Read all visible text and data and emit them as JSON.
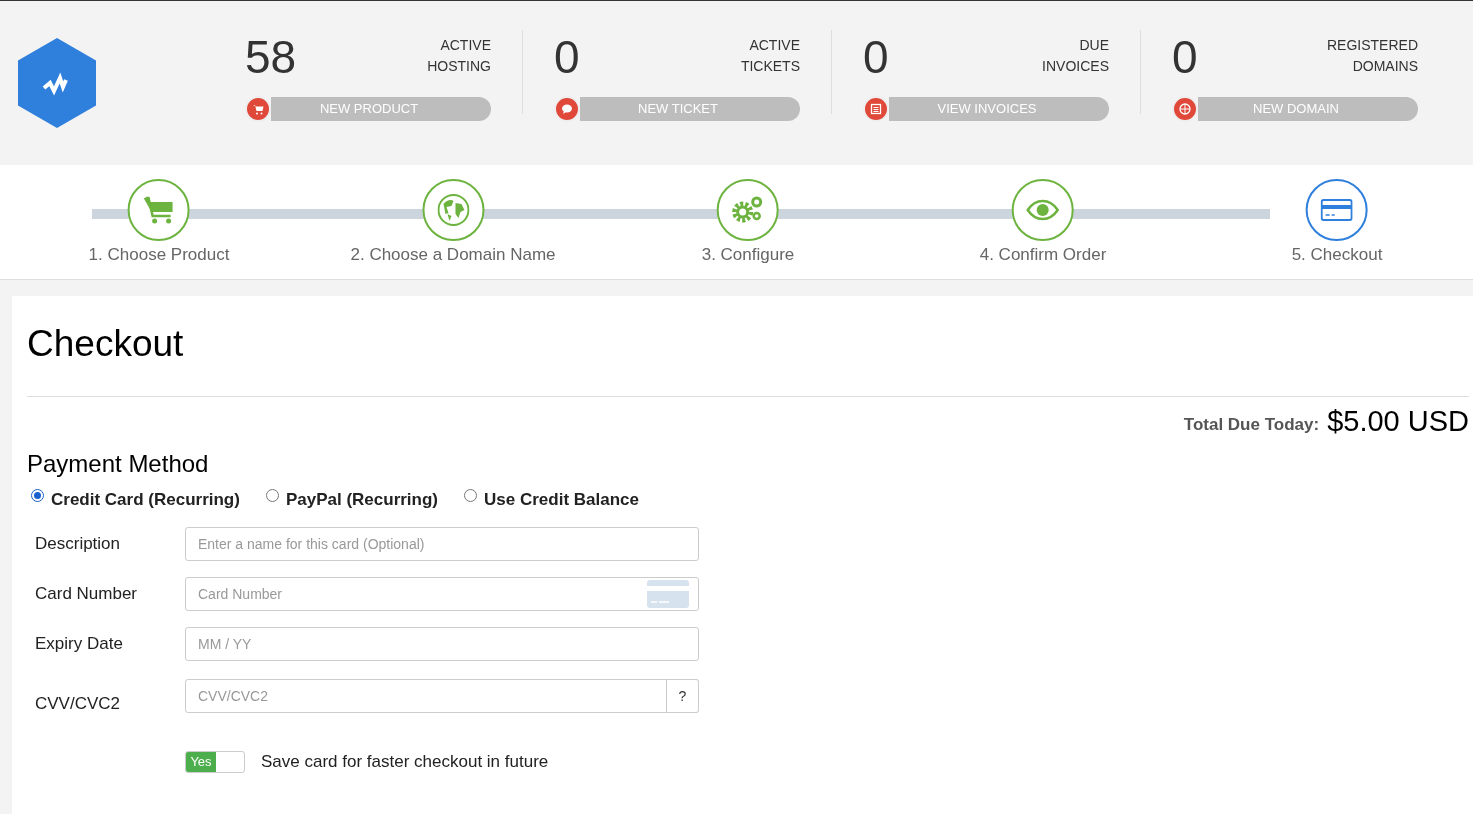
{
  "stats": [
    {
      "count": "58",
      "label_lines": [
        "ACTIVE",
        "HOSTING"
      ],
      "button": "NEW PRODUCT"
    },
    {
      "count": "0",
      "label_lines": [
        "ACTIVE",
        "TICKETS"
      ],
      "button": "NEW TICKET"
    },
    {
      "count": "0",
      "label_lines": [
        "DUE",
        "INVOICES"
      ],
      "button": "VIEW INVOICES"
    },
    {
      "count": "0",
      "label_lines": [
        "REGISTERED",
        "DOMAINS"
      ],
      "button": "NEW DOMAIN"
    }
  ],
  "steps": [
    {
      "label": "1. Choose Product",
      "selected": false
    },
    {
      "label": "2. Choose a Domain Name",
      "selected": false
    },
    {
      "label": "3. Configure",
      "selected": false
    },
    {
      "label": "4. Confirm Order",
      "selected": false
    },
    {
      "label": "5. Checkout",
      "selected": true
    }
  ],
  "page_title": "Checkout",
  "total": {
    "label": "Total Due Today:",
    "amount": "$5.00 USD"
  },
  "payment_method": {
    "heading": "Payment Method",
    "options": [
      {
        "label": "Credit Card (Recurring)",
        "selected": true
      },
      {
        "label": "PayPal (Recurring)",
        "selected": false
      },
      {
        "label": "Use Credit Balance",
        "selected": false
      }
    ]
  },
  "fields": [
    {
      "label": "Description",
      "placeholder": "Enter a name for this card (Optional)",
      "kind": "plain"
    },
    {
      "label": "Card Number",
      "placeholder": "Card Number",
      "kind": "card"
    },
    {
      "label": "Expiry Date",
      "placeholder": "MM / YY",
      "kind": "plain"
    },
    {
      "label": "CVV/CVC2",
      "placeholder": "CVV/CVC2",
      "kind": "help",
      "addon": "?"
    }
  ],
  "save_card": {
    "on": true,
    "toggle_text": "Yes",
    "label": "Save card for faster checkout in future"
  }
}
